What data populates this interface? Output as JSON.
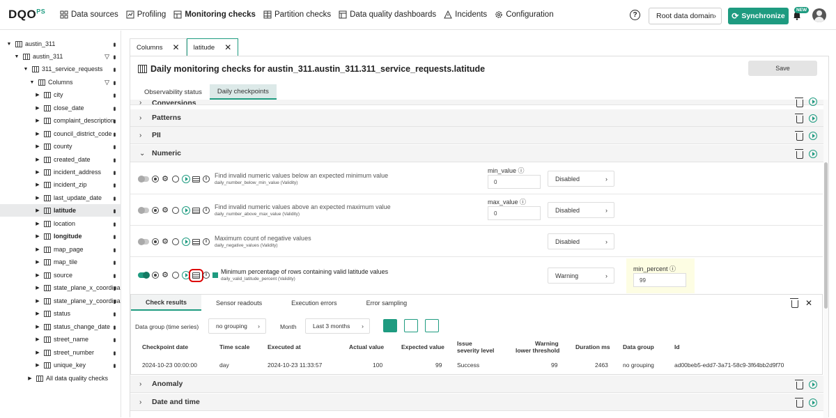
{
  "app": {
    "logo": "DQO",
    "logo_sup": "PS"
  },
  "nav": [
    {
      "label": "Data sources",
      "icon": "data-sources-icon"
    },
    {
      "label": "Profiling",
      "icon": "profiling-icon"
    },
    {
      "label": "Monitoring checks",
      "icon": "monitoring-icon"
    },
    {
      "label": "Partition checks",
      "icon": "partition-icon"
    },
    {
      "label": "Data quality dashboards",
      "icon": "dashboard-icon"
    },
    {
      "label": "Incidents",
      "icon": "warning-icon"
    },
    {
      "label": "Configuration",
      "icon": "gear-icon"
    }
  ],
  "topright": {
    "help": "?",
    "root_domain": "Root data domain",
    "sync": "Synchronize",
    "new_badge": "NEW"
  },
  "tree": [
    {
      "label": "austin_311",
      "level": 0
    },
    {
      "label": "austin_311",
      "level": 1
    },
    {
      "label": "311_service_requests",
      "level": 2
    },
    {
      "label": "Columns",
      "level": 3
    },
    {
      "label": "city"
    },
    {
      "label": "close_date"
    },
    {
      "label": "complaint_description"
    },
    {
      "label": "council_district_code"
    },
    {
      "label": "county"
    },
    {
      "label": "created_date"
    },
    {
      "label": "incident_address"
    },
    {
      "label": "incident_zip"
    },
    {
      "label": "last_update_date"
    },
    {
      "label": "latitude"
    },
    {
      "label": "location"
    },
    {
      "label": "longitude"
    },
    {
      "label": "map_page"
    },
    {
      "label": "map_tile"
    },
    {
      "label": "source"
    },
    {
      "label": "state_plane_x_coordina"
    },
    {
      "label": "state_plane_y_coordina"
    },
    {
      "label": "status"
    },
    {
      "label": "status_change_date"
    },
    {
      "label": "street_name"
    },
    {
      "label": "street_number"
    },
    {
      "label": "unique_key"
    },
    {
      "label": "All data quality checks"
    }
  ],
  "tabs": [
    {
      "label": "Columns"
    },
    {
      "label": "latitude"
    }
  ],
  "header": {
    "title": "Daily monitoring checks for austin_311.austin_311.311_service_requests.latitude",
    "save": "Save"
  },
  "subtabs": [
    {
      "label": "Observability status"
    },
    {
      "label": "Daily checkpoints"
    }
  ],
  "categories": {
    "conversions": "Conversions",
    "patterns": "Patterns",
    "pii": "PII",
    "numeric": "Numeric",
    "anomaly": "Anomaly",
    "datetime": "Date and time"
  },
  "checks": [
    {
      "name": "Find invalid numeric values below an expected minimum value",
      "sub": "daily_number_below_min_value (Validity)",
      "param": "min_value",
      "value": "0",
      "severity": "Disabled"
    },
    {
      "name": "Find invalid numeric values above an expected maximum value",
      "sub": "daily_number_above_max_value (Validity)",
      "param": "max_value",
      "value": "0",
      "severity": "Disabled"
    },
    {
      "name": "Maximum count of negative values",
      "sub": "daily_negative_values (Validity)",
      "severity": "Disabled"
    },
    {
      "name": "Minimum percentage of rows containing valid latitude values",
      "sub": "daily_valid_latitude_percent (Validity)",
      "severity": "Warning",
      "err_param": "min_percent",
      "err_value": "99"
    }
  ],
  "results": {
    "tabs": [
      "Check results",
      "Sensor readouts",
      "Execution errors",
      "Error sampling"
    ],
    "group_label": "Data group (time series)",
    "group_value": "no grouping",
    "month_label": "Month",
    "month_value": "Last 3 months",
    "headers": {
      "checkpoint": "Checkpoint date",
      "scale": "Time scale",
      "executed": "Executed at",
      "actual": "Actual value",
      "expected": "Expected value",
      "severity1": "Issue",
      "severity2": "severity level",
      "warn1": "Warning",
      "warn2": "lower threshold",
      "duration": "Duration ms",
      "group": "Data group",
      "id": "Id"
    },
    "row": {
      "checkpoint": "2024-10-23 00:00:00",
      "scale": "day",
      "executed": "2024-10-23 11:33:57",
      "actual": "100",
      "expected": "99",
      "severity": "Success",
      "warn": "99",
      "duration": "2463",
      "group": "no grouping",
      "id": "ad00beb5-edd7-3a71-58c9-3f64bb2d9f70"
    }
  },
  "colors": {
    "accent": "#1e9b80"
  }
}
